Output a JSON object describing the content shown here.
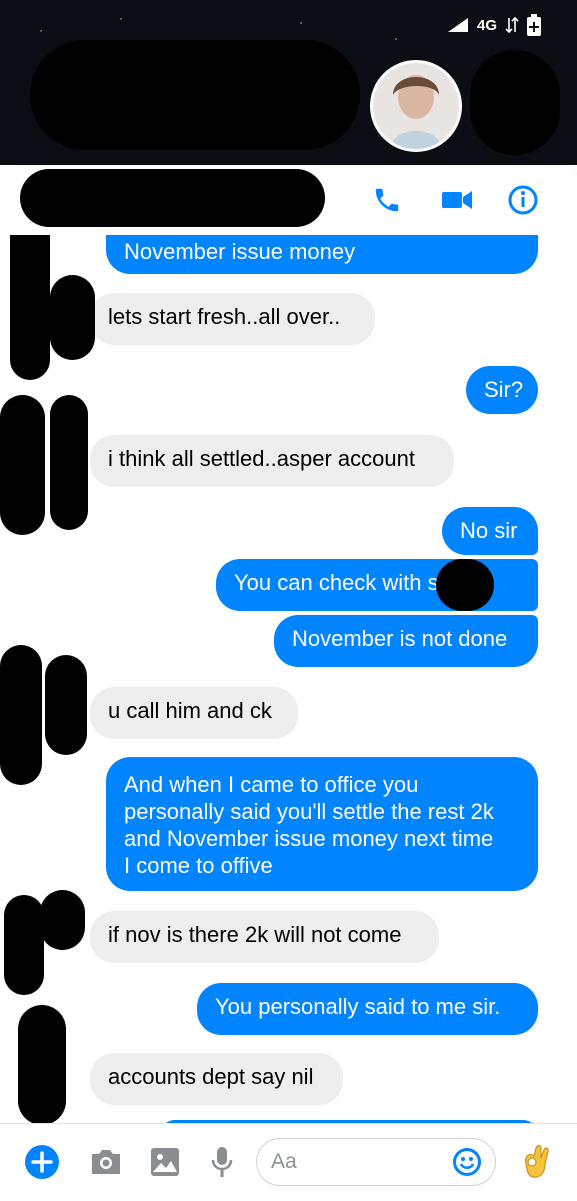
{
  "status": {
    "network": "4G"
  },
  "accent": "#0084ff",
  "messages": [
    {
      "side": "out",
      "text": "November issue money"
    },
    {
      "side": "in",
      "text": "lets start fresh..all over.."
    },
    {
      "side": "out",
      "text": "Sir?"
    },
    {
      "side": "in",
      "text": "i think all settled..asper account"
    },
    {
      "side": "out",
      "text": "No sir"
    },
    {
      "side": "out",
      "text": "You can check with sir"
    },
    {
      "side": "out",
      "text": "November is not done"
    },
    {
      "side": "in",
      "text": "u call him and ck"
    },
    {
      "side": "out",
      "line1": "And when I came to office you",
      "line2": "personally said you'll settle the rest 2k",
      "line3": "and November issue money next time",
      "line4": "I come to offive"
    },
    {
      "side": "in",
      "text": "if nov is there 2k will not come"
    },
    {
      "side": "out",
      "text": "You personally said to me sir."
    },
    {
      "side": "in",
      "text": "accounts dept say nil"
    }
  ],
  "composer": {
    "placeholder": "Aa"
  },
  "icons": {
    "call": "phone-icon",
    "video": "video-camera-icon",
    "info": "info-icon",
    "plus": "plus-icon",
    "camera": "camera-icon",
    "gallery": "image-icon",
    "mic": "microphone-icon",
    "emoji": "emoji-icon",
    "reaction": "ok-hand-icon"
  }
}
